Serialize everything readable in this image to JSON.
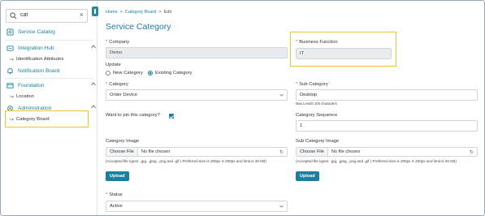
{
  "search": {
    "value": "cat"
  },
  "sidebar": {
    "items": [
      {
        "label": "Service Catalog"
      },
      {
        "label": "Integration Hub"
      },
      {
        "label": "Identification Attributes"
      },
      {
        "label": "Notification Board"
      },
      {
        "label": "Foundation"
      },
      {
        "label": "Location"
      },
      {
        "label": "Administration"
      },
      {
        "label": "Category Board"
      }
    ]
  },
  "breadcrumb": {
    "home": "Home",
    "sep1": ">",
    "section": "Category Board",
    "sep2": ">",
    "current": "Edit"
  },
  "page": {
    "title": "Service Category"
  },
  "form": {
    "company": {
      "label": "Company",
      "value": "Demo"
    },
    "business_function": {
      "label": "Business Function",
      "value": "IT"
    },
    "update": {
      "label": "Update",
      "opt_new": "New Category",
      "opt_existing": "Existing Category"
    },
    "category": {
      "label": "Category",
      "value": "Order Device"
    },
    "sub_category": {
      "label": "Sub Category",
      "value": "Desktop",
      "note": "Max Length 100 characters"
    },
    "pin": {
      "label": "Want to pin this category?"
    },
    "category_sequence": {
      "label": "Category Sequence",
      "value": "1"
    },
    "category_image": {
      "label": "Category Image",
      "choose": "Choose File",
      "no_file": "No file chosen",
      "hint": "(Accepted file types: .jpg, .jpeg, .png and .gif ) Preferred size is 200px X 200px and limit is 20 KB)",
      "upload": "Upload"
    },
    "sub_category_image": {
      "label": "Sub Category Image",
      "choose": "Choose File",
      "no_file": "No file chosen",
      "hint": "(Accepted file types: .jpg, .jpeg, .png and .gif ) Preferred size is 200px X 200px and limit is 20 KB)",
      "upload": "Upload"
    },
    "status": {
      "label": "Status",
      "value": "Active"
    }
  },
  "colors": {
    "accent": "#1c7fa0",
    "highlight": "#f1c232",
    "required": "#d9534f"
  }
}
